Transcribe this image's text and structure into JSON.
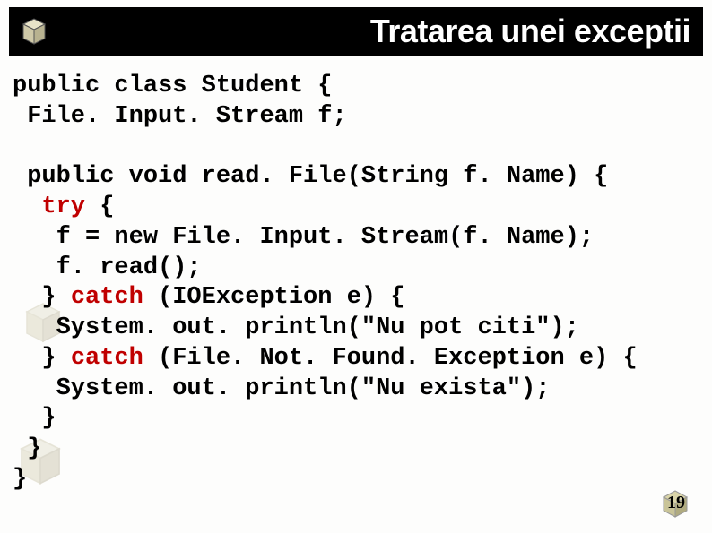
{
  "header": {
    "title": "Tratarea unei exceptii"
  },
  "code": {
    "l1": "public class Student {",
    "l2": " File. Input. Stream f;",
    "l3": "",
    "l4": " public void read. File(String f. Name) {",
    "l5a": "  ",
    "l5b": "try",
    "l5c": " {",
    "l6": "   f = new File. Input. Stream(f. Name);",
    "l7": "   f. read();",
    "l8a": "  } ",
    "l8b": "catch",
    "l8c": " (IOException e) {",
    "l9": "   System. out. println(\"Nu pot citi\");",
    "l10a": "  } ",
    "l10b": "catch",
    "l10c": " (File. Not. Found. Exception e) {",
    "l11": "   System. out. println(\"Nu exista\");",
    "l12": "  }",
    "l13": " }",
    "l14": "}"
  },
  "page_number": "19"
}
